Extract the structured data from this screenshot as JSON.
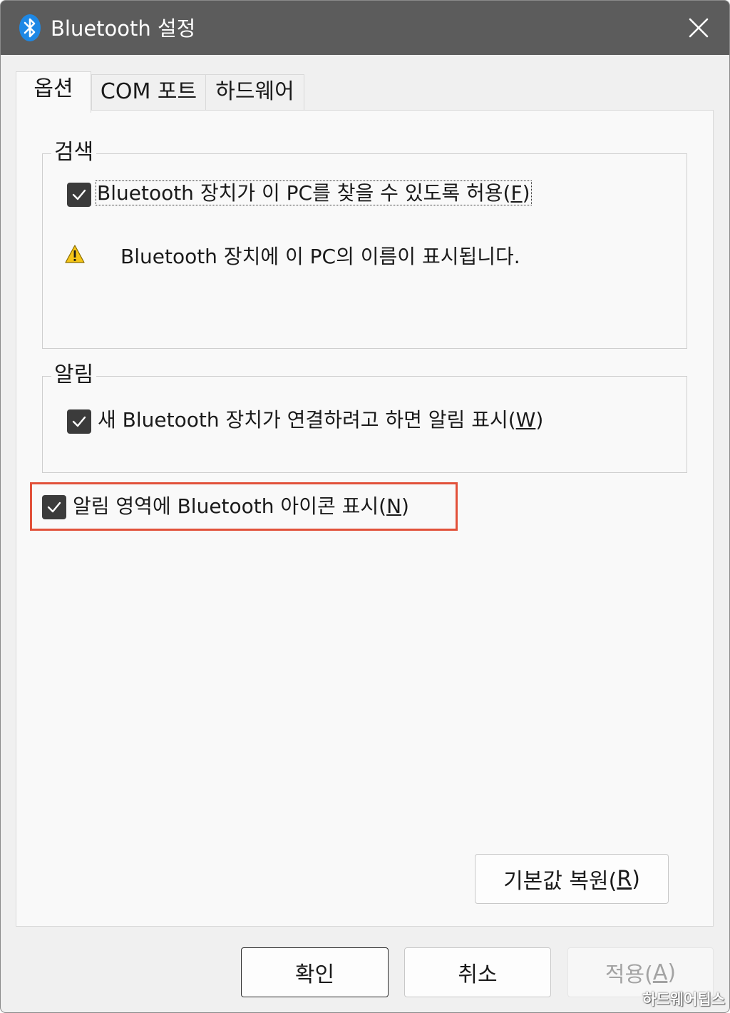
{
  "window": {
    "title": "Bluetooth 설정",
    "close_symbol": "✕",
    "icon": "bluetooth-icon"
  },
  "tabs": [
    {
      "label": "옵션",
      "active": true
    },
    {
      "label": "COM 포트",
      "active": false
    },
    {
      "label": "하드웨어",
      "active": false
    }
  ],
  "discovery": {
    "legend": "검색",
    "allow": {
      "checked": true,
      "text": "Bluetooth 장치가 이 PC를 찾을 수 있도록 허용(",
      "accel": "F",
      "tail": ")"
    },
    "warning": {
      "icon": "warning-icon",
      "text": "Bluetooth 장치에 이 PC의 이름이 표시됩니다."
    }
  },
  "notifications": {
    "legend": "알림",
    "alert": {
      "checked": true,
      "text": "새 Bluetooth 장치가 연결하려고 하면 알림 표시(",
      "accel": "W",
      "tail": ")"
    }
  },
  "tray_icon": {
    "checked": true,
    "text": "알림 영역에 Bluetooth 아이콘 표시(",
    "accel": "N",
    "tail": ")"
  },
  "buttons": {
    "restore": {
      "text": "기본값 복원(",
      "accel": "R",
      "tail": ")"
    },
    "ok": "확인",
    "cancel": "취소",
    "apply": {
      "text": "적용(",
      "accel": "A",
      "tail": ")"
    }
  },
  "watermark": "하드웨어팁스",
  "colors": {
    "titlebar": "#5c5c5c",
    "bluetooth_blue": "#1e88e5",
    "highlight": "#e2513a",
    "checkbox": "#3b3b3b",
    "warning": "#f5c518"
  }
}
